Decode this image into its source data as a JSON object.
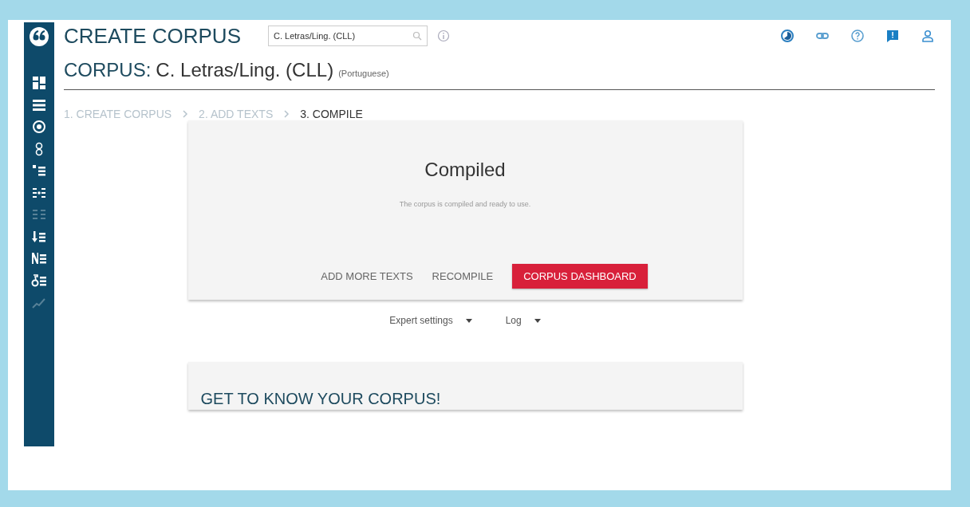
{
  "header": {
    "title": "CREATE CORPUS",
    "search": {
      "value": "C. Letras/Ling. (CLL)"
    }
  },
  "corpus": {
    "label": "CORPUS:",
    "name": "C. Letras/Ling. (CLL)",
    "language": "(Portuguese)"
  },
  "sidebar": {
    "items": [
      {
        "kind": "dashboard",
        "disabled": false
      },
      {
        "kind": "list",
        "disabled": false
      },
      {
        "kind": "target",
        "disabled": false
      },
      {
        "kind": "links",
        "disabled": false
      },
      {
        "kind": "dotlist",
        "disabled": false
      },
      {
        "kind": "split",
        "disabled": false
      },
      {
        "kind": "grid",
        "disabled": true
      },
      {
        "kind": "arrowlist",
        "disabled": false
      },
      {
        "kind": "nlist",
        "disabled": false
      },
      {
        "kind": "deltalist",
        "disabled": false
      },
      {
        "kind": "trend",
        "disabled": true
      }
    ]
  },
  "steps": [
    {
      "label": "1. CREATE CORPUS",
      "selected": false
    },
    {
      "label": "2. ADD TEXTS",
      "selected": false
    },
    {
      "label": "3. COMPILE",
      "selected": true
    }
  ],
  "status_card": {
    "title": "Compiled",
    "message": "The corpus is compiled and ready to use.",
    "buttons": [
      {
        "label": "ADD MORE TEXTS",
        "kind": "text"
      },
      {
        "label": "RECOMPILE",
        "kind": "text"
      },
      {
        "label": "CORPUS DASHBOARD",
        "kind": "primary"
      }
    ]
  },
  "dropdowns": [
    {
      "label": "Expert settings"
    },
    {
      "label": "Log"
    }
  ],
  "intro_card": {
    "title": "GET TO KNOW YOUR CORPUS!"
  }
}
